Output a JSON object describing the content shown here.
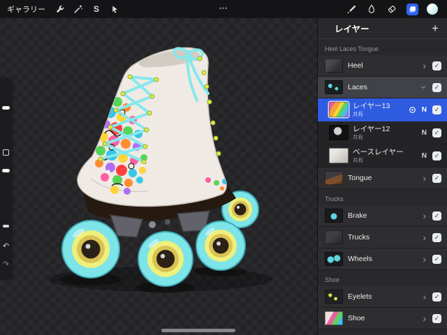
{
  "topbar": {
    "gallery_label": "ギャラリー",
    "selection_glyph": "S"
  },
  "glyphs": {
    "add": "+",
    "more": "•••",
    "check": "✓",
    "chevron": "›",
    "undo": "↶",
    "redo": "↷"
  },
  "layers": {
    "title": "レイヤー",
    "rows": [
      {
        "type": "section",
        "label": "Heel Laces Tongue"
      },
      {
        "type": "group",
        "label": "Heel",
        "visible": true
      },
      {
        "type": "group",
        "label": "Laces",
        "visible": true,
        "expanded": true,
        "highlighted": true
      },
      {
        "type": "layer",
        "label": "レイヤー13",
        "subtitle": "共有",
        "blend": "N",
        "visible": true,
        "selected": true
      },
      {
        "type": "layer",
        "label": "レイヤー12",
        "subtitle": "共有",
        "blend": "N",
        "visible": true
      },
      {
        "type": "layer",
        "label": "ベースレイヤー",
        "subtitle": "共有",
        "blend": "N",
        "visible": true
      },
      {
        "type": "group",
        "label": "Tongue",
        "visible": true
      },
      {
        "type": "section",
        "label": "Trucks"
      },
      {
        "type": "group",
        "label": "Brake",
        "visible": true
      },
      {
        "type": "group",
        "label": "Trucks",
        "visible": true
      },
      {
        "type": "group",
        "label": "Wheels",
        "visible": true
      },
      {
        "type": "section",
        "label": "Shoe"
      },
      {
        "type": "group",
        "label": "Eyelets",
        "visible": true
      },
      {
        "type": "group",
        "label": "Shoe",
        "visible": true
      }
    ]
  },
  "colors": {
    "selection_blue": "#2e5be0",
    "accent_blue": "#2f63ec",
    "lace_cyan": "#7de4e8",
    "wheel_yellow": "#eef07c"
  }
}
